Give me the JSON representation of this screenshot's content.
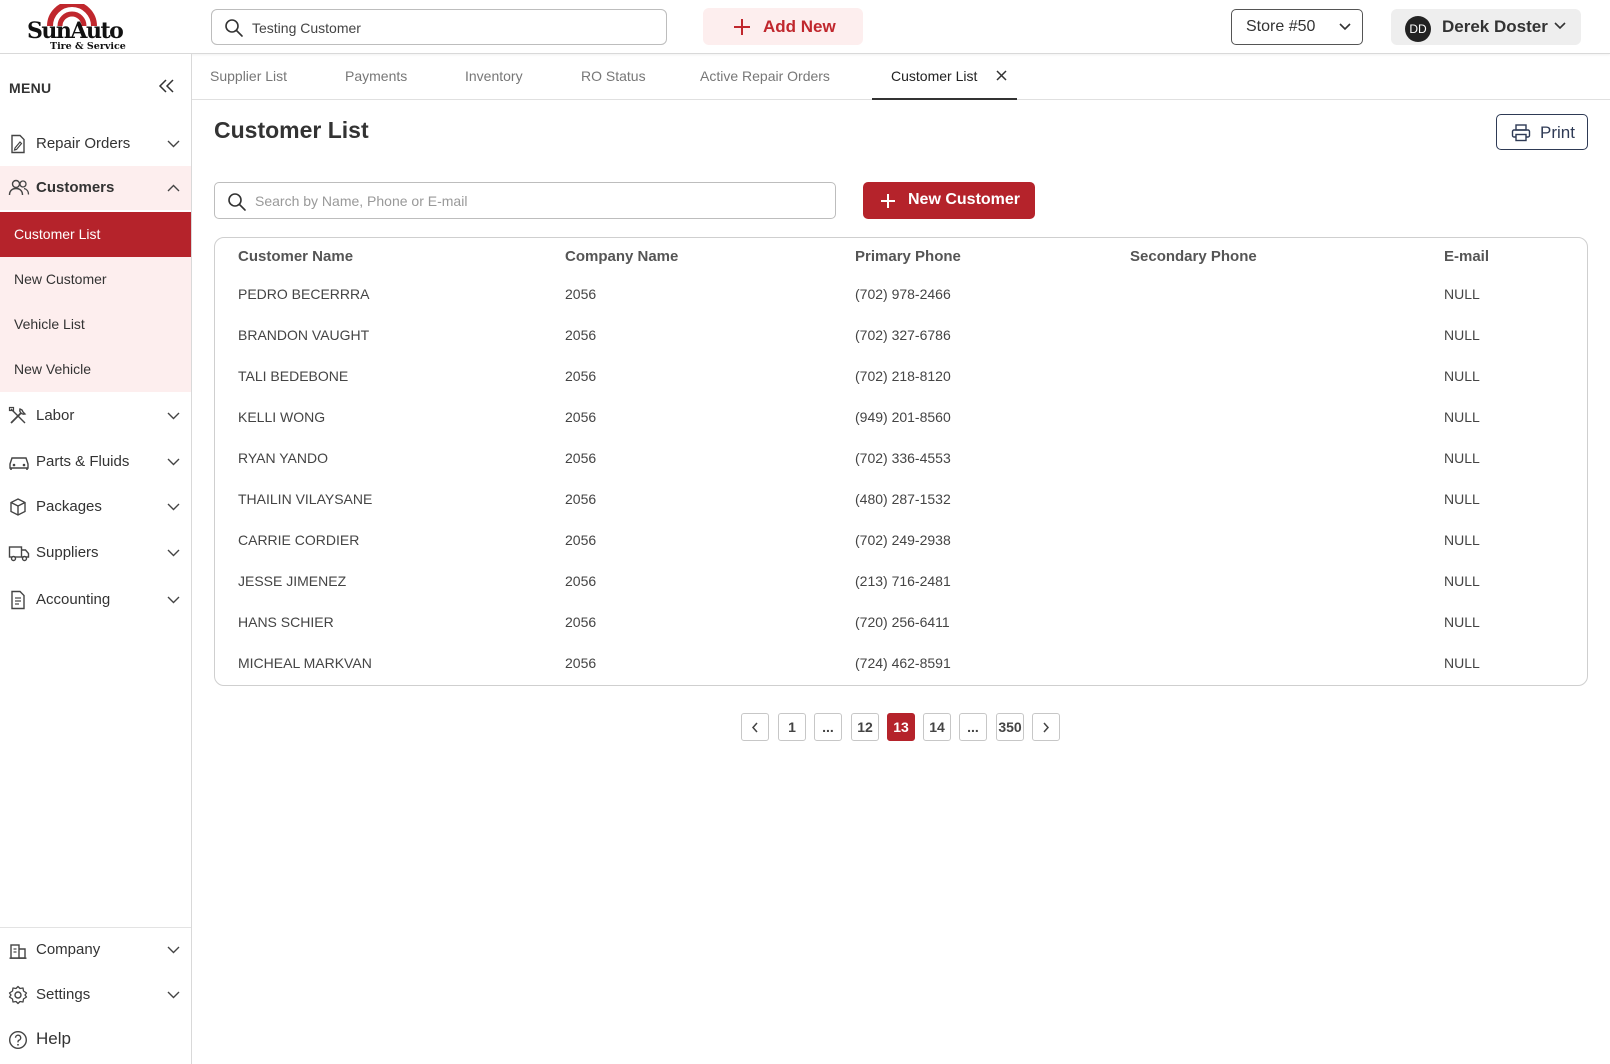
{
  "app": {
    "logo_name": "SunAuto",
    "logo_tagline": "Tire & Service"
  },
  "header": {
    "search_value": "Testing Customer",
    "add_new_label": "Add New",
    "store_label": "Store #50",
    "user_initials": "DD",
    "user_name": "Derek Doster"
  },
  "sidebar": {
    "menu_title": "MENU",
    "items": [
      {
        "label": "Repair Orders",
        "icon": "document-edit-icon"
      },
      {
        "label": "Customers",
        "icon": "users-icon"
      },
      {
        "label": "Labor",
        "icon": "tools-icon"
      },
      {
        "label": "Parts & Fluids",
        "icon": "car-icon"
      },
      {
        "label": "Packages",
        "icon": "box-icon"
      },
      {
        "label": "Suppliers",
        "icon": "truck-icon"
      },
      {
        "label": "Accounting",
        "icon": "receipt-icon"
      }
    ],
    "customer_sub_items": [
      "Customer List",
      "New Customer",
      "Vehicle List",
      "New Vehicle"
    ],
    "bottom_items": [
      {
        "label": "Company",
        "icon": "building-icon"
      },
      {
        "label": "Settings",
        "icon": "gear-icon"
      },
      {
        "label": "Help",
        "icon": "help-icon"
      }
    ]
  },
  "tabs": [
    "Supplier List",
    "Payments",
    "Inventory",
    "RO Status",
    "Active Repair Orders",
    "Customer List"
  ],
  "main": {
    "title": "Customer List",
    "print_label": "Print",
    "search_placeholder": "Search by Name, Phone or E-mail",
    "new_customer_label": "New Customer"
  },
  "table": {
    "columns": [
      "Customer Name",
      "Company Name",
      "Primary Phone",
      "Secondary Phone",
      "E-mail"
    ],
    "rows": [
      [
        "PEDRO BECERRRA",
        "2056",
        "(702) 978-2466",
        "",
        "NULL"
      ],
      [
        "BRANDON VAUGHT",
        "2056",
        "(702) 327-6786",
        "",
        "NULL"
      ],
      [
        "TALI BEDEBONE",
        "2056",
        "(702) 218-8120",
        "",
        "NULL"
      ],
      [
        "KELLI WONG",
        "2056",
        "(949) 201-8560",
        "",
        "NULL"
      ],
      [
        "RYAN YANDO",
        "2056",
        "(702) 336-4553",
        "",
        "NULL"
      ],
      [
        "THAILIN VILAYSANE",
        "2056",
        "(480) 287-1532",
        "",
        "NULL"
      ],
      [
        "CARRIE CORDIER",
        "2056",
        "(702) 249-2938",
        "",
        "NULL"
      ],
      [
        "JESSE JIMENEZ",
        "2056",
        "(213) 716-2481",
        "",
        "NULL"
      ],
      [
        "HANS SCHIER",
        "2056",
        "(720) 256-6411",
        "",
        "NULL"
      ],
      [
        "MICHEAL MARKVAN",
        "2056",
        "(724) 462-8591",
        "",
        "NULL"
      ]
    ]
  },
  "pagination": {
    "pages": [
      "1",
      "...",
      "12",
      "13",
      "14",
      "...",
      "350"
    ],
    "current": "13"
  },
  "colors": {
    "brand_red": "#b5232b",
    "accent_light": "#fdeeee"
  }
}
